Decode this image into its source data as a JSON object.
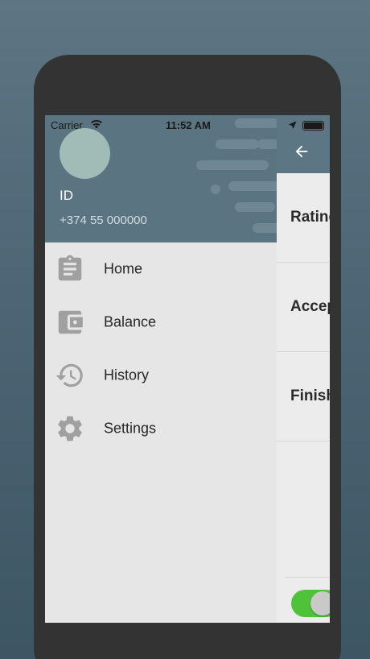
{
  "status_bar": {
    "carrier": "Carrier",
    "time": "11:52 AM",
    "icons": [
      "wifi-icon",
      "location-arrow-icon",
      "battery-icon"
    ]
  },
  "drawer": {
    "user": {
      "id_label": "ID",
      "phone": "+374 55 000000"
    },
    "menu": [
      {
        "label": "Home",
        "icon": "clipboard-icon"
      },
      {
        "label": "Balance",
        "icon": "wallet-icon"
      },
      {
        "label": "History",
        "icon": "history-icon"
      },
      {
        "label": "Settings",
        "icon": "gear-icon"
      }
    ]
  },
  "main": {
    "back_icon": "back-arrow-icon",
    "rows": [
      {
        "label": "Rating"
      },
      {
        "label": "Accepted"
      },
      {
        "label": "Finished"
      }
    ],
    "toggle_on": true
  },
  "colors": {
    "background": "#4d6574",
    "header": "#5a7481",
    "avatar": "#a1bcb6",
    "toggle": "#4fc23a",
    "icon_gray": "#9e9e9e"
  }
}
